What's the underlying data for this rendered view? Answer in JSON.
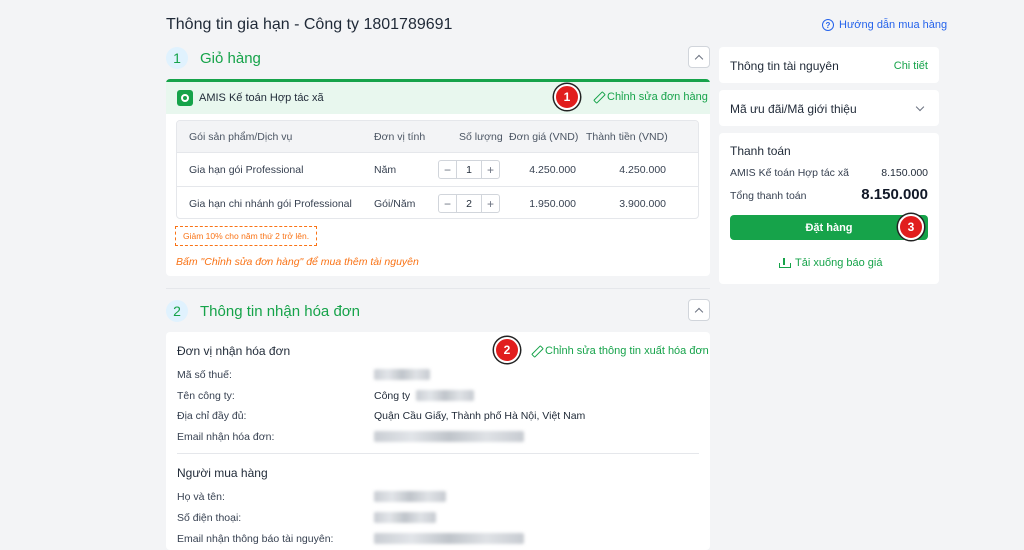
{
  "header": {
    "title": "Thông tin gia hạn - Công ty 1801789691",
    "help_link": "Hướng dẫn mua hàng"
  },
  "cart": {
    "section_number": "1",
    "section_title": "Giỏ hàng",
    "product_name": "AMIS Kế toán Hợp tác xã",
    "edit_link": "Chỉnh sửa đơn hàng",
    "table": {
      "headers": [
        "Gói sản phẩm/Dịch vụ",
        "Đơn vị tính",
        "Số lượng",
        "Đơn giá (VND)",
        "Thành tiền (VND)"
      ],
      "rows": [
        {
          "name": "Gia hạn gói Professional",
          "unit": "Năm",
          "qty": "1",
          "price": "4.250.000",
          "total": "4.250.000"
        },
        {
          "name": "Gia hạn chi nhánh gói Professional",
          "unit": "Gói/Năm",
          "qty": "2",
          "price": "1.950.000",
          "total": "3.900.000"
        }
      ]
    },
    "discount_note": "Giảm 10% cho năm thứ 2 trở lên.",
    "hint": "Bấm \"Chỉnh sửa đơn hàng\" để mua thêm tài nguyên"
  },
  "invoice": {
    "section_number": "2",
    "section_title": "Thông tin nhận hóa đơn",
    "edit_link": "Chỉnh sửa thông tin xuất hóa đơn",
    "unit_heading": "Đơn vị nhận hóa đơn",
    "tax_label": "Mã số thuế:",
    "company_label": "Tên công ty:",
    "company_value": "Công ty",
    "address_label": "Địa chỉ đầy đủ:",
    "address_value": "Quận Cầu Giấy, Thành phố Hà Nội, Việt Nam",
    "email_label": "Email nhận hóa đơn:",
    "buyer_heading": "Người mua hàng",
    "name_label": "Họ và tên:",
    "phone_label": "Số điện thoại:",
    "notify_email_label": "Email nhận thông báo tài nguyên:"
  },
  "sidebar": {
    "resource_info": "Thông tin tài nguyên",
    "detail_link": "Chi tiết",
    "promo": "Mã ưu đãi/Mã giới thiệu",
    "payment_title": "Thanh toán",
    "line_item_label": "AMIS Kế toán Hợp tác xã",
    "line_item_value": "8.150.000",
    "total_label": "Tổng thanh toán",
    "total_value": "8.150.000",
    "order_button": "Đặt hàng",
    "download_quote": "Tải xuống báo giá"
  },
  "callouts": [
    "1",
    "2",
    "3"
  ]
}
